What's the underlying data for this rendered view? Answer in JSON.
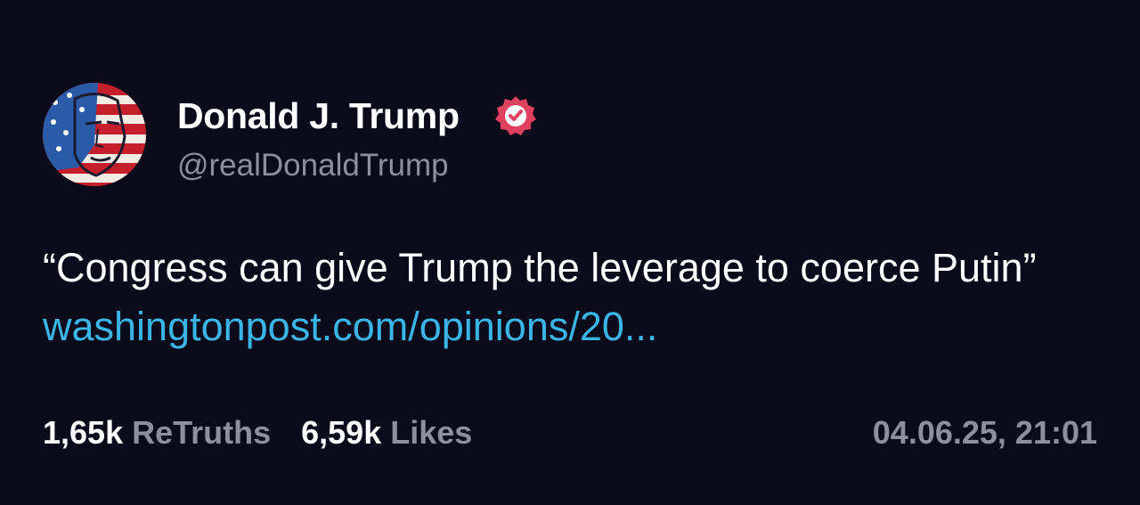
{
  "author": {
    "display_name": "Donald J. Trump",
    "handle": "@realDonaldTrump",
    "verified": true,
    "avatar_icon": "flag-portrait-avatar"
  },
  "post": {
    "text": "“Congress can give Trump the leverage to coerce Putin” ",
    "link_text": "washingtonpost.com/opinions/20..."
  },
  "stats": {
    "retruths_count": "1,65k",
    "retruths_label": "ReTruths",
    "likes_count": "6,59k",
    "likes_label": "Likes"
  },
  "timestamp": "04.06.25, 21:01",
  "colors": {
    "background": "#0b0a1a",
    "link": "#3ab5e6",
    "muted": "#8f8e9d",
    "verified_badge": "#e0415e"
  }
}
